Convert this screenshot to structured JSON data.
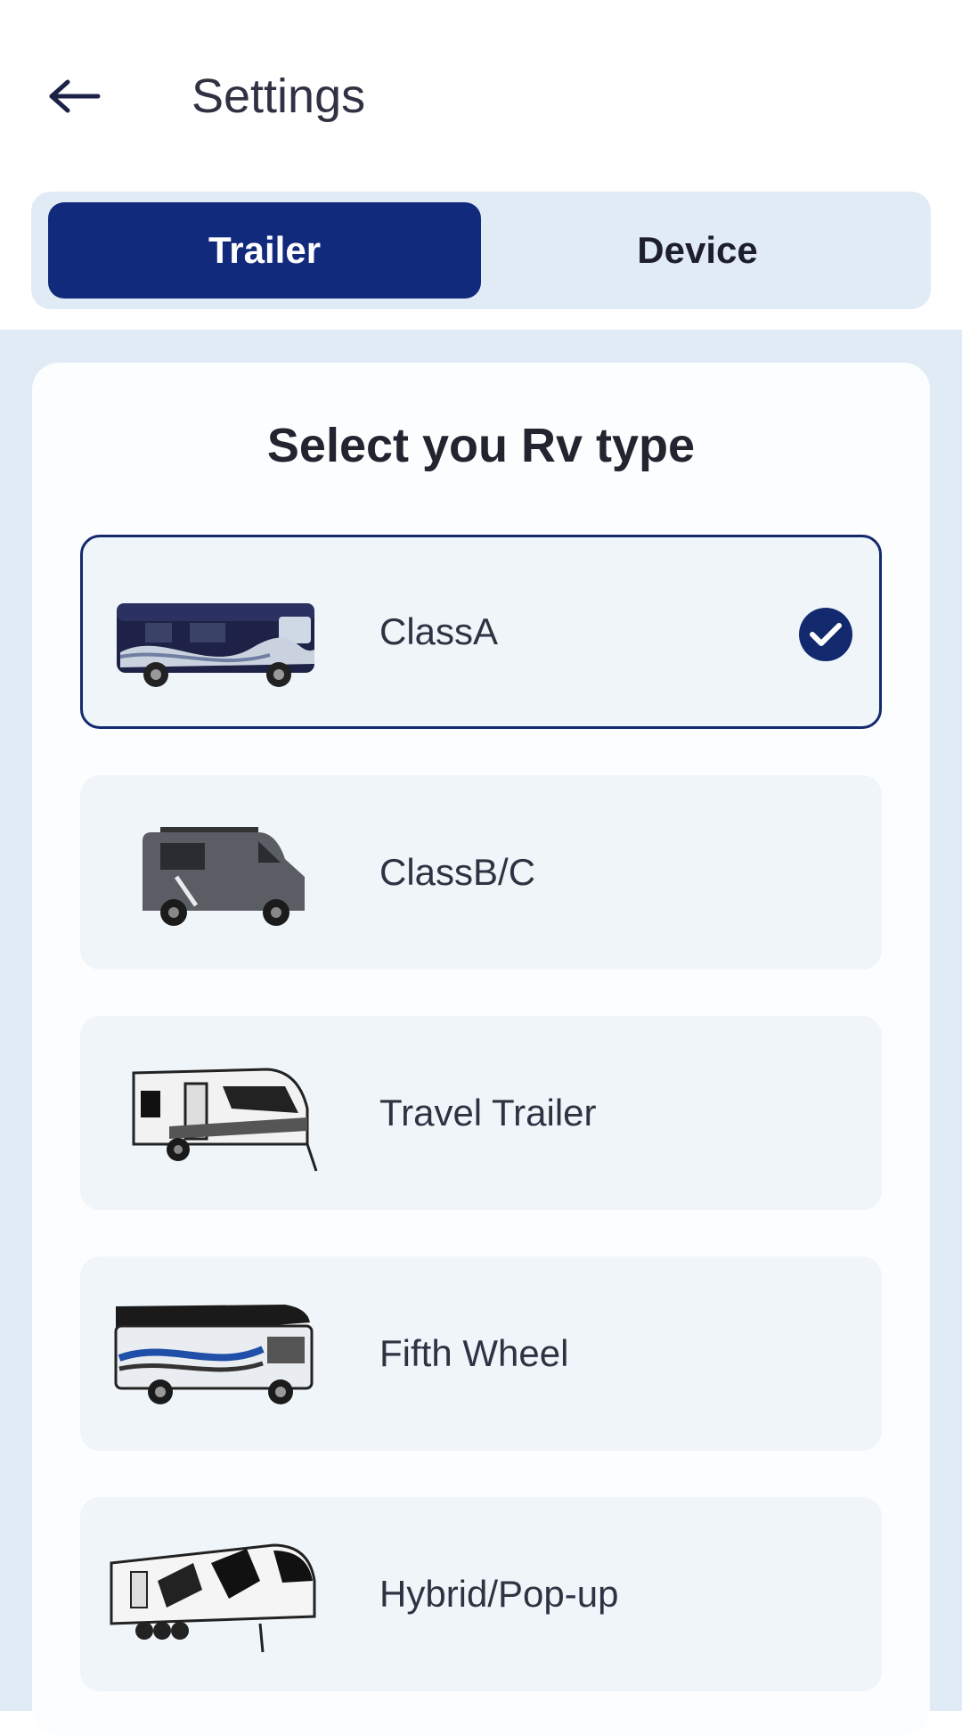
{
  "header": {
    "back_icon": "arrow-left-icon",
    "title": "Settings"
  },
  "tabs": [
    {
      "label": "Trailer",
      "active": true
    },
    {
      "label": "Device",
      "active": false
    }
  ],
  "card": {
    "title": "Select you Rv type"
  },
  "options": [
    {
      "label": "ClassA",
      "icon": "class-a-motorhome-image",
      "selected": true
    },
    {
      "label": "ClassB/C",
      "icon": "camper-van-image",
      "selected": false
    },
    {
      "label": "Travel Trailer",
      "icon": "travel-trailer-image",
      "selected": false
    },
    {
      "label": "Fifth Wheel",
      "icon": "fifth-wheel-image",
      "selected": false
    },
    {
      "label": "Hybrid/Pop-up",
      "icon": "hybrid-popup-image",
      "selected": false
    }
  ],
  "colors": {
    "accent": "#122a7c",
    "segment_bg": "#e1ebf6",
    "option_bg": "#f0f5f9"
  }
}
